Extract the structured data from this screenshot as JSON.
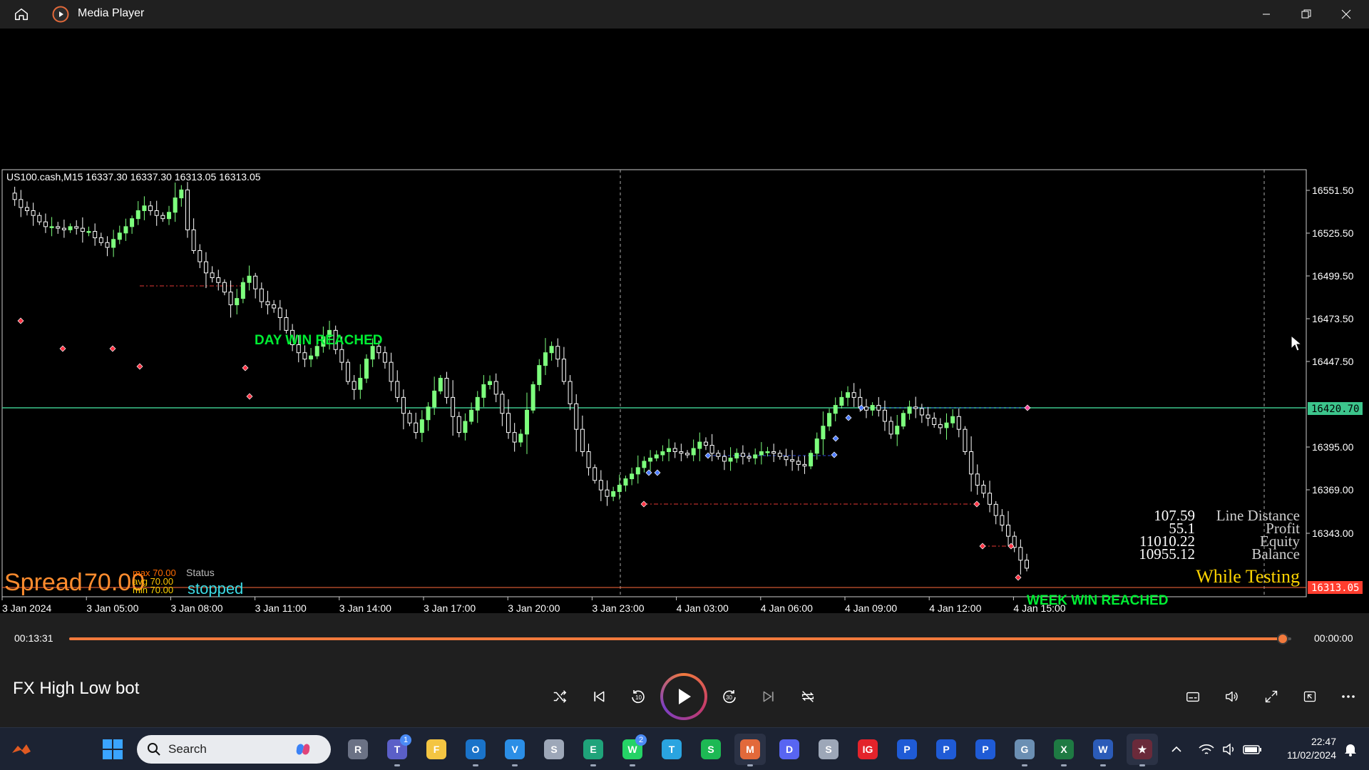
{
  "window": {
    "title": "Media Player"
  },
  "chart_data": {
    "type": "candlestick",
    "header": "US100.cash,M15  16337.30 16337.30 16313.05 16313.05",
    "y_ticks": [
      "16551.50",
      "16525.50",
      "16499.50",
      "16473.50",
      "16447.50",
      "16395.00",
      "16369.00",
      "16343.00"
    ],
    "ylim": [
      16300,
      16560
    ],
    "x_ticks": [
      "3 Jan 2024",
      "3 Jan 05:00",
      "3 Jan 08:00",
      "3 Jan 11:00",
      "3 Jan 14:00",
      "3 Jan 17:00",
      "3 Jan 20:00",
      "3 Jan 23:00",
      "4 Jan 03:00",
      "4 Jan 06:00",
      "4 Jan 09:00",
      "4 Jan 12:00",
      "4 Jan 15:00"
    ],
    "hline_green": "16420.70",
    "last_price": "16313.05",
    "annotations": {
      "day_win": "DAY WIN REACHED",
      "week_win": "WEEK WIN REACHED"
    },
    "stats": [
      {
        "value": "107.59",
        "label": "Line Distance"
      },
      {
        "value": "55.1",
        "label": "Profit"
      },
      {
        "value": "11010.22",
        "label": "Equity"
      },
      {
        "value": "10955.12",
        "label": "Balance"
      }
    ],
    "testing": "While Testing",
    "spread_label": "Spread",
    "spread_value": "70.00",
    "max_label": "max 70.00",
    "avg_label": "avg 70.00",
    "min_label": "min 70.00",
    "status_label": "Status",
    "status_value": "stopped",
    "series": [
      16548,
      16544,
      16539,
      16537,
      16534,
      16530,
      16527,
      16527,
      16526,
      16525,
      16527,
      16526,
      16524,
      16524,
      16520,
      16517,
      16514,
      16519,
      16523,
      16527,
      16532,
      16537,
      16540,
      16537,
      16534,
      16532,
      16536,
      16545,
      16550,
      16525,
      16512,
      16505,
      16498,
      16495,
      16492,
      16486,
      16478,
      16482,
      16492,
      16496,
      16488,
      16480,
      16478,
      16476,
      16470,
      16462,
      16453,
      16448,
      16444,
      16446,
      16452,
      16458,
      16462,
      16450,
      16442,
      16430,
      16425,
      16432,
      16444,
      16452,
      16448,
      16442,
      16430,
      16420,
      16410,
      16404,
      16398,
      16406,
      16414,
      16424,
      16432,
      16420,
      16408,
      16398,
      16405,
      16412,
      16420,
      16428,
      16430,
      16422,
      16410,
      16398,
      16392,
      16397,
      16412,
      16428,
      16440,
      16448,
      16452,
      16444,
      16430,
      16416,
      16400,
      16386,
      16376,
      16368,
      16362,
      16358,
      16361,
      16365,
      16369,
      16372,
      16376,
      16380,
      16382,
      16384,
      16386,
      16388,
      16386,
      16385,
      16384,
      16388,
      16392,
      16390,
      16385,
      16383,
      16380,
      16382,
      16385,
      16383,
      16382,
      16384,
      16386,
      16386,
      16385,
      16383,
      16381,
      16380,
      16378,
      16377,
      16385,
      16394,
      16402,
      16410,
      16415,
      16420,
      16423,
      16420,
      16414,
      16412,
      16415,
      16412,
      16405,
      16397,
      16402,
      16410,
      16414,
      16413,
      16409,
      16407,
      16403,
      16401,
      16404,
      16408,
      16400,
      16386,
      16372,
      16365,
      16360,
      16353,
      16346,
      16340,
      16333,
      16326,
      16318,
      16313
    ]
  },
  "player": {
    "elapsed": "00:13:31",
    "remaining": "00:00:00",
    "progress": 0.9932,
    "video_title": "FX High Low bot",
    "accent": "#f27a3d"
  },
  "taskbar": {
    "search_placeholder": "Search",
    "time": "22:47",
    "date": "11/02/2024",
    "badges": {
      "teams": "1",
      "whatsapp": "2"
    }
  },
  "colors": {
    "chart_bg": "#000000",
    "chart_border": "#cccccc",
    "bull": "#7dff7d",
    "bear": "#ffffff",
    "green_line": "#3cc58c",
    "red_level": "#e53935",
    "accent_text": "#ff9f1c",
    "cyan": "#3cdce6",
    "win_text": "#00ee33"
  }
}
